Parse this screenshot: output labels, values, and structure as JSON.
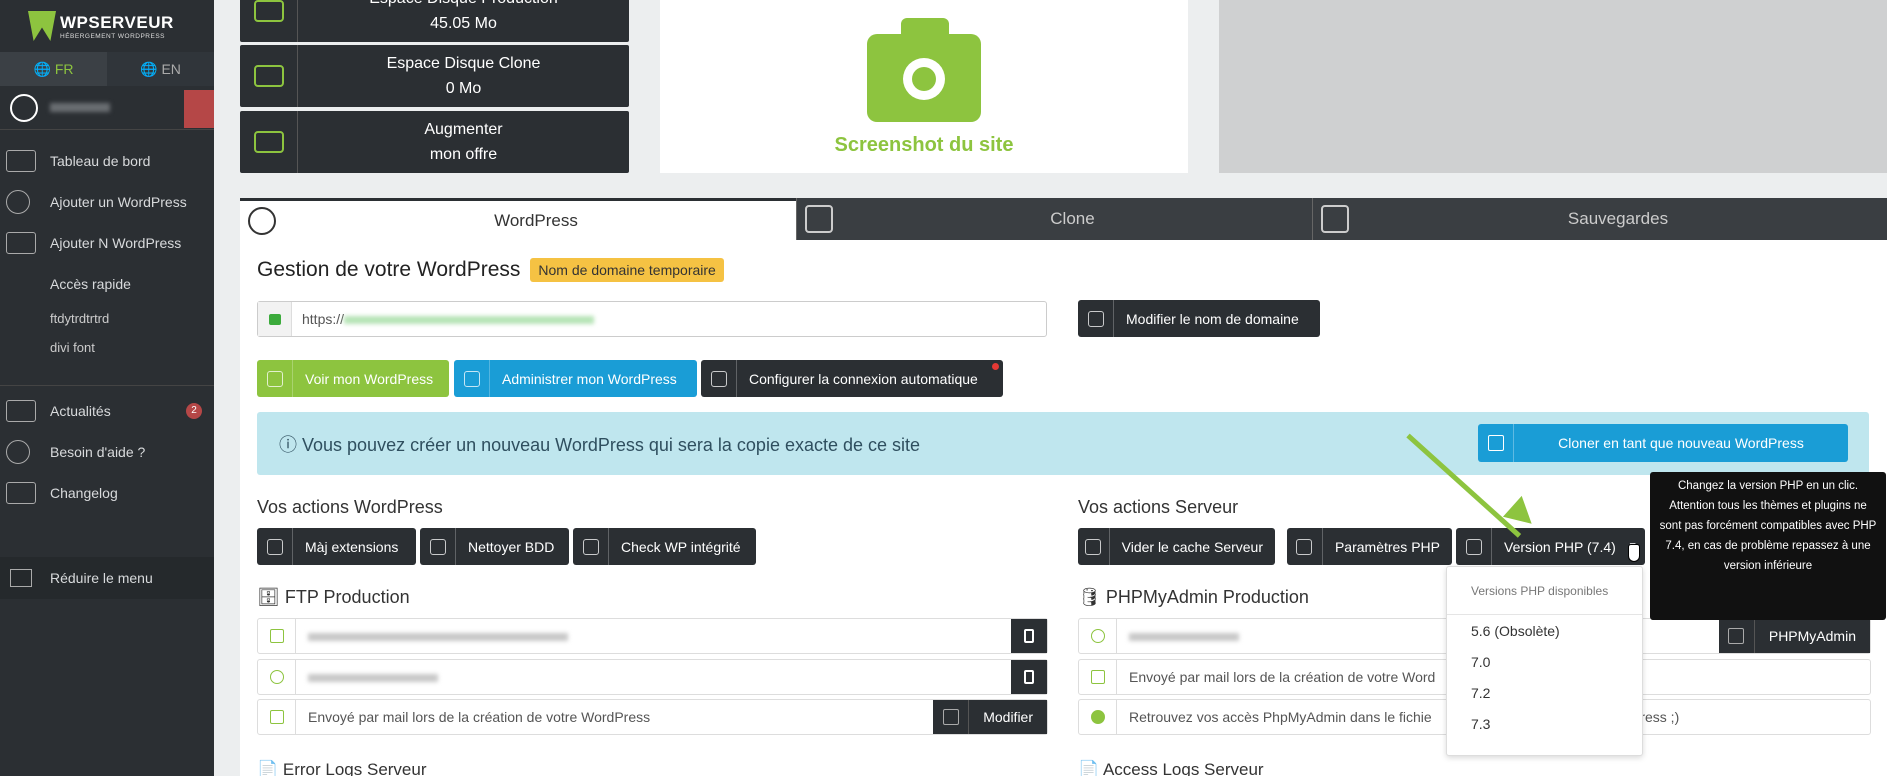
{
  "brand": {
    "logo_text": "WPSERVEUR",
    "logo_sub": "HÉBERGEMENT WORDPRESS"
  },
  "lang": {
    "fr": "FR",
    "en": "EN"
  },
  "sidebar": {
    "items": [
      {
        "label": "Tableau de bord"
      },
      {
        "label": "Ajouter un WordPress"
      },
      {
        "label": "Ajouter N WordPress"
      },
      {
        "label": "Accès rapide"
      }
    ],
    "quick_links": [
      "ftdytrdtrtrd",
      "divi font"
    ],
    "news": {
      "label": "Actualités",
      "badge": "2"
    },
    "help": "Besoin d'aide ?",
    "changelog": "Changelog",
    "reduce": "Réduire le menu"
  },
  "stats": {
    "prod": {
      "title": "Espace Disque Production",
      "value": "45.05 Mo"
    },
    "clone": {
      "title": "Espace Disque Clone",
      "value": "0 Mo"
    },
    "upgrade": {
      "line1": "Augmenter",
      "line2": "mon offre"
    }
  },
  "screenshot": {
    "label": "Screenshot du site"
  },
  "tabs": {
    "wordpress": "WordPress",
    "clone": "Clone",
    "backups": "Sauvegardes"
  },
  "main": {
    "title": "Gestion de votre WordPress",
    "temp_badge": "Nom de domaine temporaire",
    "url_prefix": "https://",
    "modify_domain": "Modifier le nom de domaine",
    "view_wp": "Voir mon WordPress",
    "admin_wp": "Administrer mon WordPress",
    "auto_login": "Configurer la connexion automatique",
    "info_text": "ⓘ Vous pouvez créer un nouveau WordPress qui sera la copie exacte de ce site",
    "clone_btn": "Cloner en tant que nouveau WordPress"
  },
  "wp_actions": {
    "title": "Vos actions WordPress",
    "update_ext": "Màj extensions",
    "clean_db": "Nettoyer BDD",
    "check_wp": "Check WP intégrité"
  },
  "server_actions": {
    "title": "Vos actions Serveur",
    "clear_cache": "Vider le cache Serveur",
    "php_params": "Paramètres PHP",
    "php_version": "Version PHP (7.4)"
  },
  "php_dropdown": {
    "header": "Versions PHP disponibles",
    "options": [
      "5.6 (Obsolète)",
      "7.0",
      "7.2",
      "7.3"
    ]
  },
  "tooltip": "Changez la version PHP en un clic. Attention tous les thèmes et plugins ne sont pas forcément compatibles avec PHP 7.4, en cas de problème repassez à une version inférieure",
  "ftp": {
    "title": "FTP Production",
    "password_text": "Envoyé par mail lors de la création de votre WordPress",
    "modify": "Modifier"
  },
  "pma": {
    "title": "PHPMyAdmin Production",
    "button": "PHPMyAdmin",
    "password_text": "Envoyé par mail lors de la création de votre Word",
    "info_text": "Retrouvez vos accès PhpMyAdmin dans le fichie",
    "info_tail": "Press ;)"
  },
  "logs": {
    "error": "Error Logs Serveur",
    "access": "Access Logs Serveur"
  }
}
